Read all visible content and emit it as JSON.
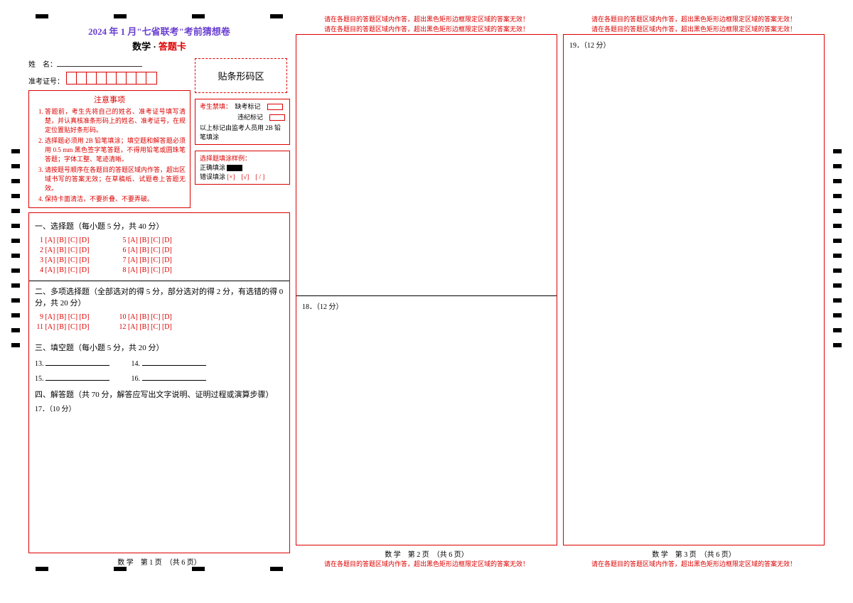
{
  "header": {
    "title": "2024 年 1 月\"七省联考\"考前猜想卷",
    "subject": "数学",
    "card": "答题卡"
  },
  "fields": {
    "name_label": "姓　名：",
    "id_label": "准考证号：",
    "barcode_label": "贴条形码区"
  },
  "notice": {
    "title": "注意事项",
    "rules": [
      "答题前，考生先将自己的姓名、准考证号填写清楚，并认真核准条形码上的姓名、准考证号，在规定位置贴好条形码。",
      "选择题必须用 2B 铅笔填涂；填空题和解答题必须用 0.5 mm 黑色签字笔答题，不得用铅笔或圆珠笔答题；字体工整、笔迹清晰。",
      "请按题号顺序在各题目的答题区域内作答，超出区域书写的答案无效；在草稿纸、试题卷上答题无效。",
      "保持卡面清洁，不要折叠、不要弄破。"
    ]
  },
  "forbid": {
    "title": "考生禁填：",
    "miss": "缺考标记",
    "violate": "违纪标记",
    "note": "以上标记由监考人员用 2B 铅笔填涂"
  },
  "sample": {
    "title": "选择题填涂样例：",
    "correct": "正确填涂",
    "wrong": "错误填涂",
    "wrong_marks": "[×]　[√]　[ / ]"
  },
  "sections": {
    "s1_title": "一、选择题（每小题 5 分，共 40 分）",
    "s2_title": "二、多项选择题（全部选对的得 5 分，部分选对的得 2 分，有选错的得 0 分，共 20 分）",
    "s3_title": "三、填空题（每小题 5 分，共 20 分）",
    "s4_title": "四、解答题（共 70 分，解答应写出文字说明、证明过程或演算步骤）",
    "q17": "17．（10 分）",
    "q18": "18．（12 分）",
    "q19": "19．（12 分）",
    "mc_opts": "[A] [B] [C] [D]",
    "mc_nums_left": [
      "1",
      "2",
      "3",
      "4"
    ],
    "mc_nums_right": [
      "5",
      "6",
      "7",
      "8"
    ],
    "ms_nums_left": [
      "9",
      "11"
    ],
    "ms_nums_right": [
      "10",
      "12"
    ],
    "fill_nums": [
      "13.",
      "14.",
      "15.",
      "16."
    ]
  },
  "footers": {
    "p1": "数 学　第 1 页　（共 6 页）",
    "p2": "数 学　第 2 页　（共 6 页）",
    "p3": "数 学　第 3 页　（共 6 页）"
  },
  "warning": "请在各题目的答题区域内作答，超出黑色矩形边框限定区域的答案无效！"
}
